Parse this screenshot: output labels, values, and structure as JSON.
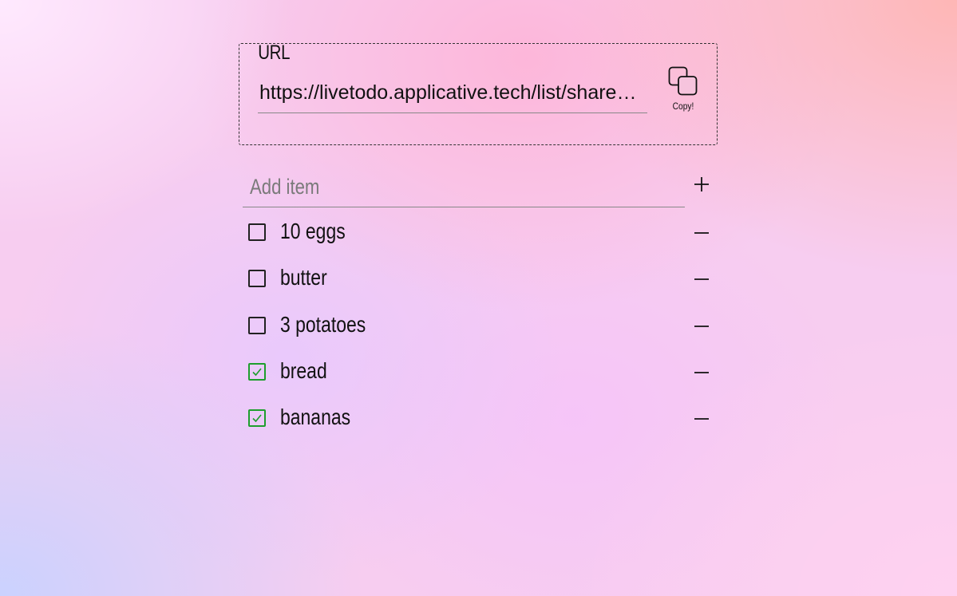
{
  "url_section": {
    "legend": "URL",
    "value": "https://livetodo.applicative.tech/list/shared-shopping-list",
    "copy_label": "Copy!",
    "copy_icon": "copy-icon"
  },
  "add_item": {
    "placeholder": "Add item",
    "add_icon": "plus-icon"
  },
  "items": [
    {
      "label": "10 eggs",
      "checked": false
    },
    {
      "label": "butter",
      "checked": false
    },
    {
      "label": "3 potatoes",
      "checked": false
    },
    {
      "label": "bread",
      "checked": true
    },
    {
      "label": "bananas",
      "checked": true
    }
  ],
  "colors": {
    "checked": "#1e9e2e",
    "unchecked": "#222222",
    "text": "#111111",
    "placeholder": "#7a7a7a"
  }
}
